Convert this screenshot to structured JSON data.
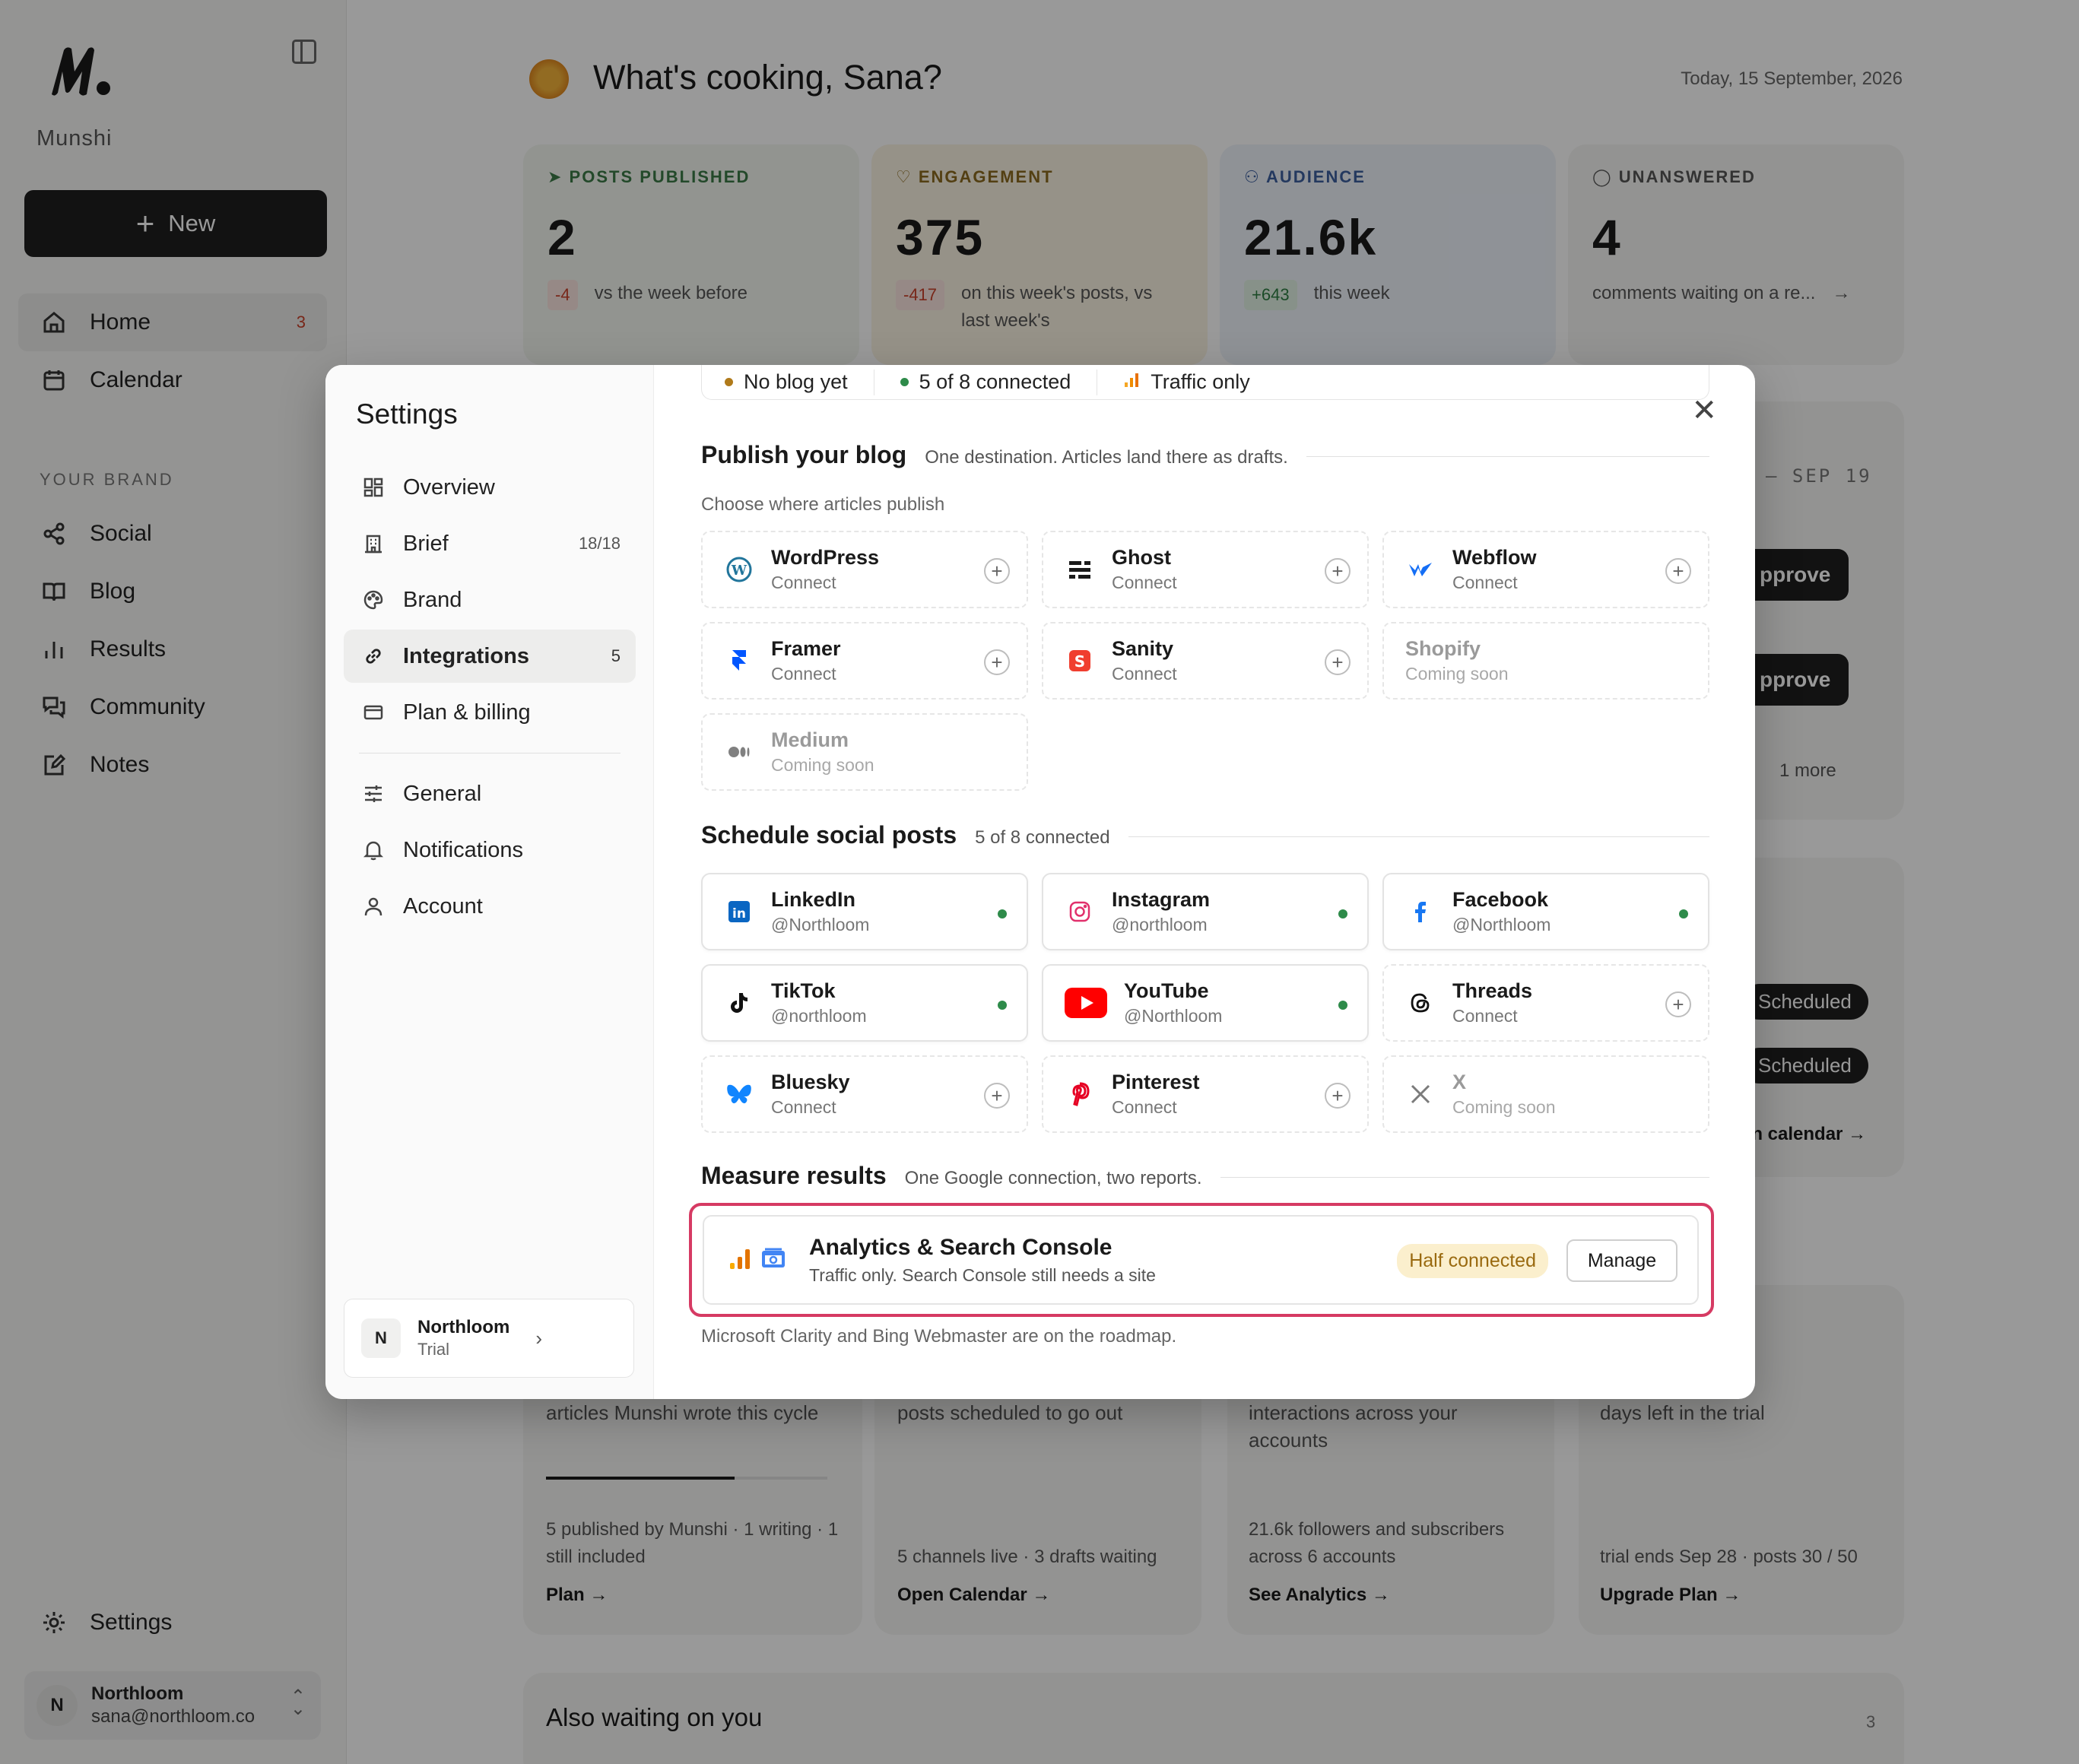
{
  "app": {
    "name": "Munshi"
  },
  "sidebar": {
    "new_label": "New",
    "primary": [
      {
        "label": "Home",
        "badge": "3"
      },
      {
        "label": "Calendar"
      }
    ],
    "section_label": "YOUR BRAND",
    "brand_items": [
      {
        "label": "Social"
      },
      {
        "label": "Blog"
      },
      {
        "label": "Results"
      },
      {
        "label": "Community"
      },
      {
        "label": "Notes"
      }
    ],
    "settings_label": "Settings",
    "account": {
      "initial": "N",
      "name": "Northloom",
      "email": "sana@northloom.co"
    }
  },
  "header": {
    "greeting": "What's cooking, Sana?",
    "date": "Today, 15 September, 2026"
  },
  "stats": [
    {
      "label": "POSTS PUBLISHED",
      "value": "2",
      "delta": "-4",
      "note": "vs the week before"
    },
    {
      "label": "ENGAGEMENT",
      "value": "375",
      "delta": "-417",
      "note": "on this week's posts, vs last week's"
    },
    {
      "label": "AUDIENCE",
      "value": "21.6k",
      "delta": "+643",
      "note": "this week"
    },
    {
      "label": "UNANSWERED",
      "value": "4",
      "note": "comments waiting on a re...",
      "arrow": "→"
    }
  ],
  "background": {
    "week_range": "– SEP 19",
    "approve": "pprove",
    "approve2": "pprove",
    "more": "1 more",
    "scheduled1": "Scheduled",
    "scheduled2": "Scheduled",
    "calendar_link": "en calendar →",
    "cards": [
      {
        "text": "articles Munshi wrote this cycle",
        "sub": "5 published by Munshi · 1 writing · 1 still included",
        "link": "Plan →",
        "progress": 0.67
      },
      {
        "text": "posts scheduled to go out",
        "sub": "5 channels live · 3 drafts waiting",
        "link": "Open Calendar →"
      },
      {
        "text": "interactions across your accounts",
        "sub": "21.6k followers and subscribers across 6 accounts",
        "link": "See Analytics →"
      },
      {
        "text": "days left in the trial",
        "sub": "trial ends Sep 28 · posts 30 / 50",
        "link": "Upgrade Plan →"
      }
    ],
    "also_waiting": "Also waiting on you",
    "also_count": "3"
  },
  "modal": {
    "title": "Settings",
    "nav": [
      {
        "label": "Overview"
      },
      {
        "label": "Brief",
        "count": "18/18"
      },
      {
        "label": "Brand"
      },
      {
        "label": "Integrations",
        "count": "5"
      },
      {
        "label": "Plan & billing"
      }
    ],
    "nav2": [
      {
        "label": "General"
      },
      {
        "label": "Notifications"
      },
      {
        "label": "Account"
      }
    ],
    "account": {
      "initial": "N",
      "name": "Northloom",
      "plan": "Trial"
    },
    "status": [
      {
        "label": "No blog yet",
        "color": "#b07a1a"
      },
      {
        "label": "5 of 8 connected",
        "color": "#2e8b4a"
      },
      {
        "label": "Traffic only"
      }
    ],
    "blog": {
      "title": "Publish your blog",
      "desc": "One destination. Articles land there as drafts.",
      "choose": "Choose where articles publish",
      "items": [
        {
          "name": "WordPress",
          "sub": "Connect"
        },
        {
          "name": "Ghost",
          "sub": "Connect"
        },
        {
          "name": "Webflow",
          "sub": "Connect"
        },
        {
          "name": "Framer",
          "sub": "Connect"
        },
        {
          "name": "Sanity",
          "sub": "Connect"
        },
        {
          "name": "Shopify",
          "sub": "Coming soon"
        },
        {
          "name": "Medium",
          "sub": "Coming soon"
        }
      ]
    },
    "social": {
      "title": "Schedule social posts",
      "desc": "5 of 8 connected",
      "items": [
        {
          "name": "LinkedIn",
          "sub": "@Northloom"
        },
        {
          "name": "Instagram",
          "sub": "@northloom"
        },
        {
          "name": "Facebook",
          "sub": "@Northloom"
        },
        {
          "name": "TikTok",
          "sub": "@northloom"
        },
        {
          "name": "YouTube",
          "sub": "@Northloom"
        },
        {
          "name": "Threads",
          "sub": "Connect"
        },
        {
          "name": "Bluesky",
          "sub": "Connect"
        },
        {
          "name": "Pinterest",
          "sub": "Connect"
        },
        {
          "name": "X",
          "sub": "Coming soon"
        }
      ]
    },
    "measure": {
      "title": "Measure results",
      "desc": "One Google connection, two reports.",
      "card_title": "Analytics & Search Console",
      "card_sub": "Traffic only. Search Console still needs a site",
      "badge": "Half connected",
      "manage": "Manage",
      "roadmap": "Microsoft Clarity and Bing Webmaster are on the roadmap."
    }
  },
  "colors": {
    "highlight": "#d63a63",
    "connected": "#2e8b4a",
    "accent_dark": "#1f1f1f"
  }
}
